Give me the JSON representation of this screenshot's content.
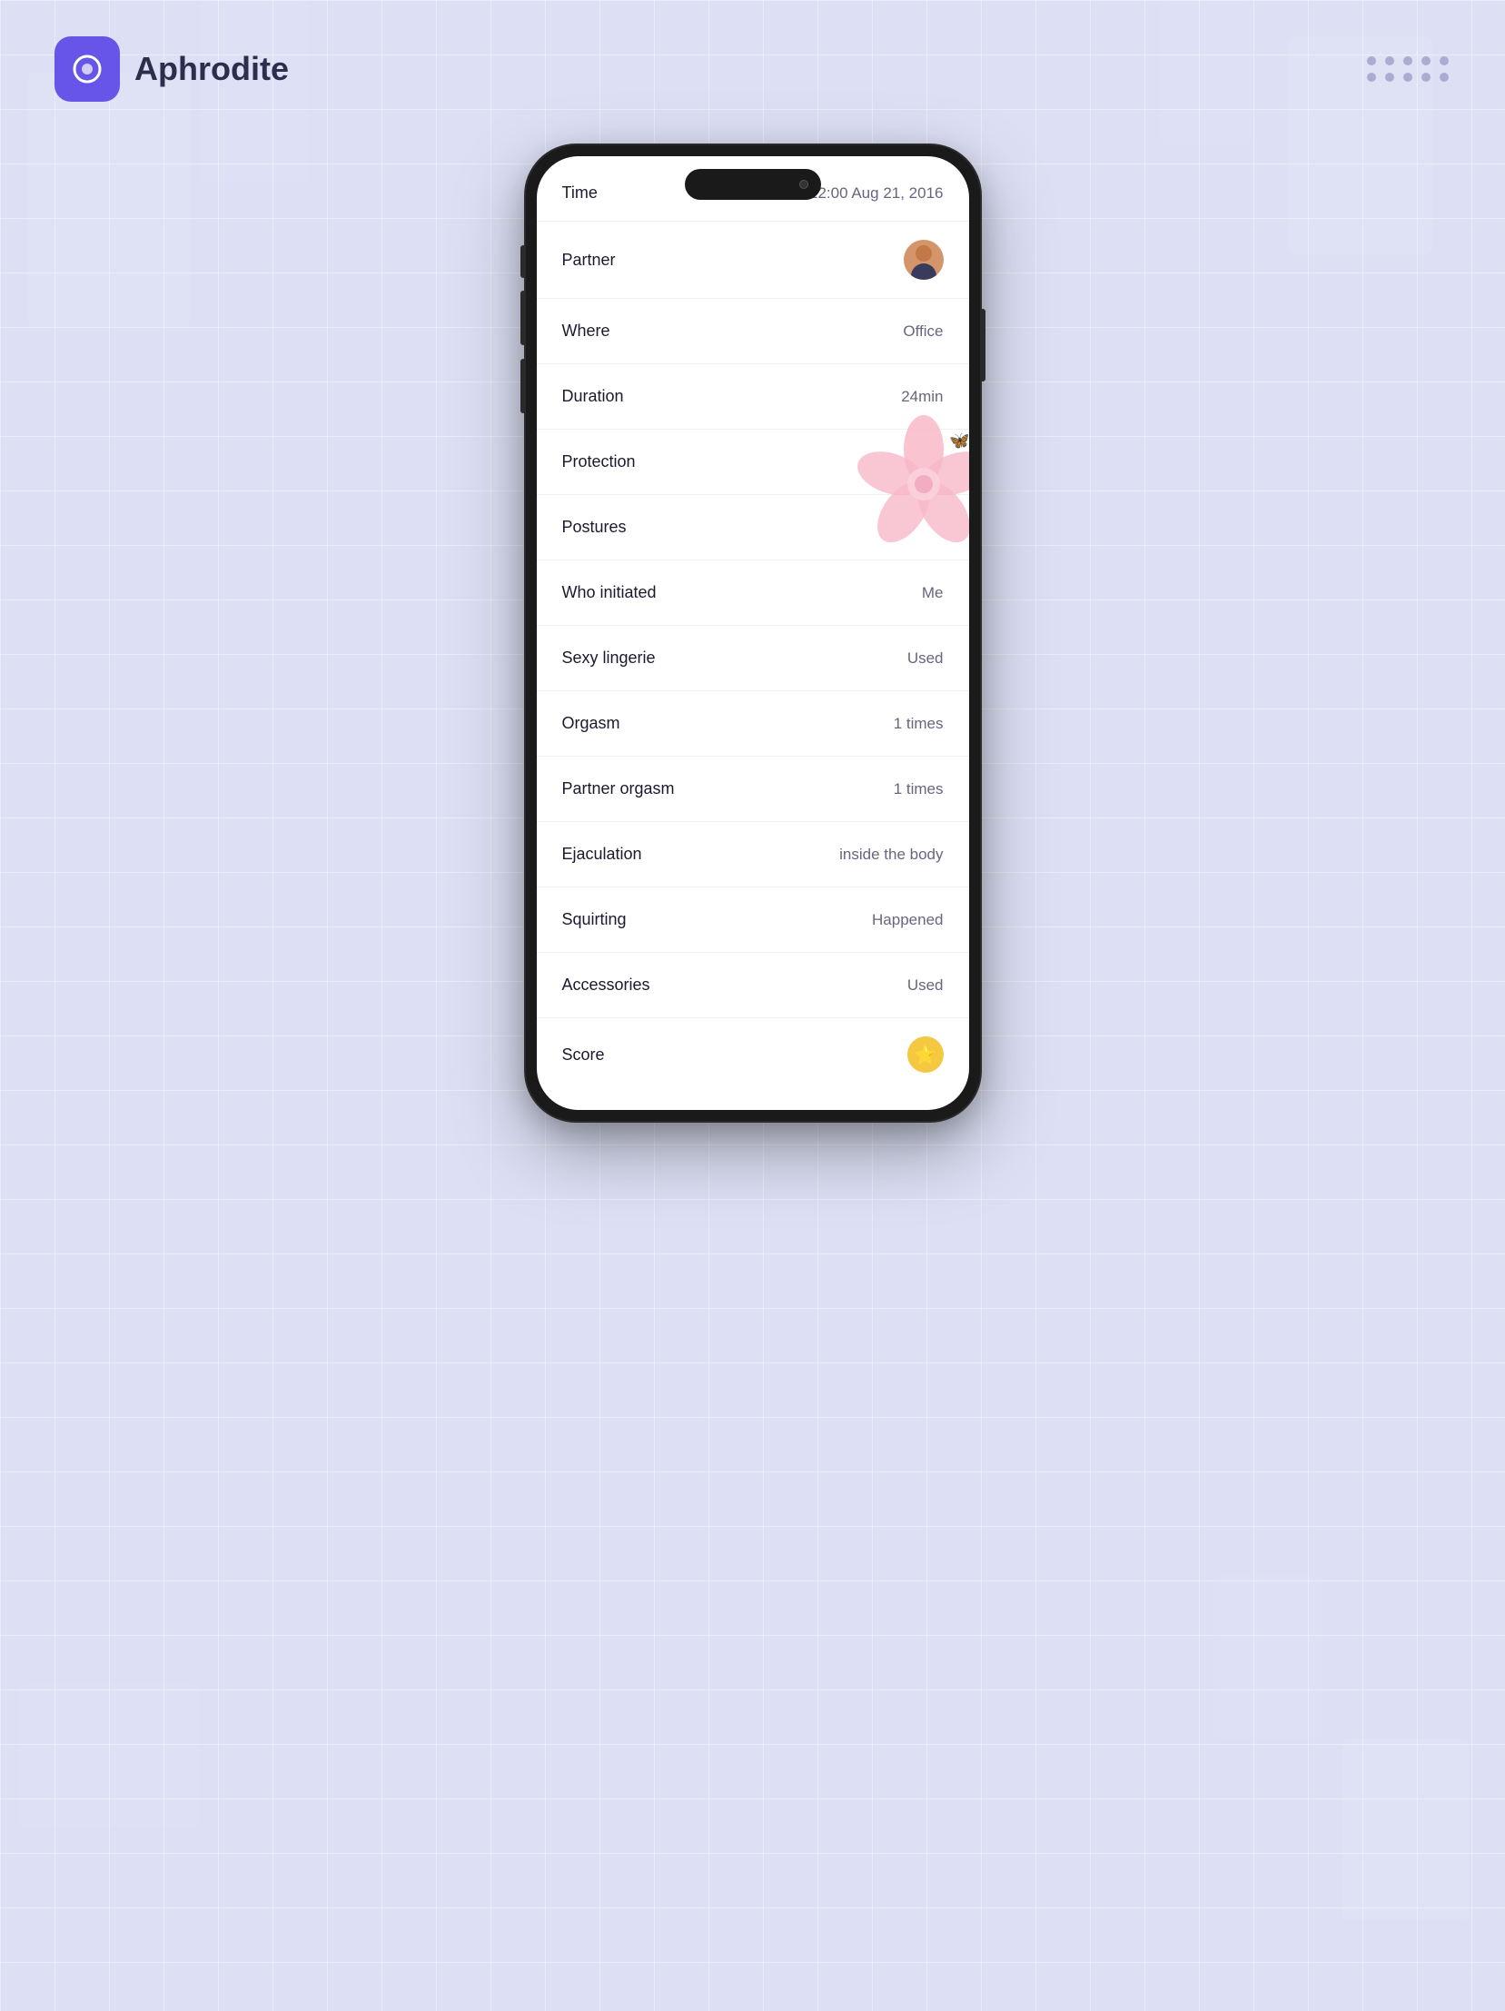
{
  "app": {
    "name": "Aphrodite",
    "logo_bg": "#6655e8"
  },
  "header": {
    "time": "12:00",
    "date": "Aug 21, 2016"
  },
  "rows": [
    {
      "label": "Time",
      "value": "12:00  Aug 21, 2016",
      "type": "text"
    },
    {
      "label": "Partner",
      "value": "",
      "type": "avatar"
    },
    {
      "label": "Where",
      "value": "Office",
      "type": "text"
    },
    {
      "label": "Duration",
      "value": "24min",
      "type": "text"
    },
    {
      "label": "Protection",
      "value": "",
      "type": "flower"
    },
    {
      "label": "Postures",
      "value": "",
      "type": "text"
    },
    {
      "label": "Who initiated",
      "value": "Me",
      "type": "text"
    },
    {
      "label": "Sexy lingerie",
      "value": "Used",
      "type": "text"
    },
    {
      "label": "Orgasm",
      "value": "1 times",
      "type": "text"
    },
    {
      "label": "Partner orgasm",
      "value": "1 times",
      "type": "text"
    },
    {
      "label": "Ejaculation",
      "value": "inside the body",
      "type": "text"
    },
    {
      "label": "Squirting",
      "value": "Happened",
      "type": "text"
    },
    {
      "label": "Accessories",
      "value": "Used",
      "type": "text"
    },
    {
      "label": "Score",
      "value": "",
      "type": "score"
    }
  ]
}
